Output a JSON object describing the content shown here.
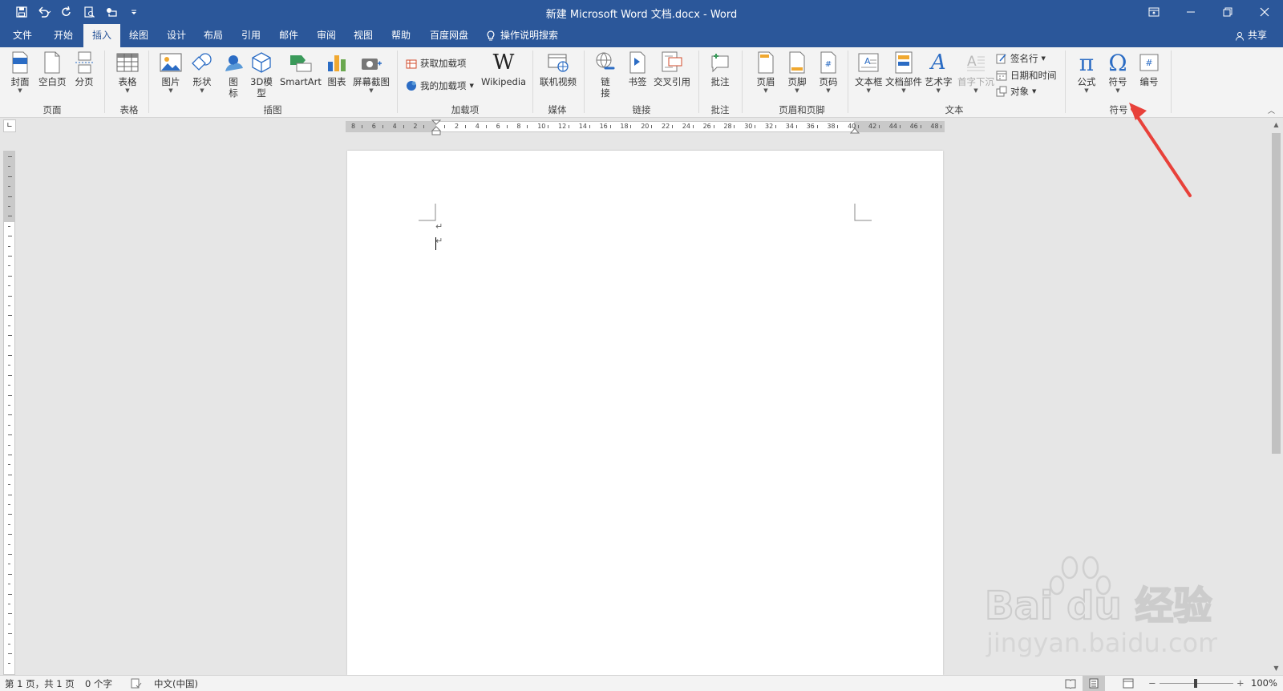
{
  "window": {
    "title": "新建 Microsoft Word 文档.docx  -  Word"
  },
  "tabs": [
    {
      "label": "文件"
    },
    {
      "label": "开始"
    },
    {
      "label": "插入",
      "active": true
    },
    {
      "label": "绘图"
    },
    {
      "label": "设计"
    },
    {
      "label": "布局"
    },
    {
      "label": "引用"
    },
    {
      "label": "邮件"
    },
    {
      "label": "审阅"
    },
    {
      "label": "视图"
    },
    {
      "label": "帮助"
    },
    {
      "label": "百度网盘"
    }
  ],
  "tellme": {
    "label": "操作说明搜索"
  },
  "share": {
    "label": "共享"
  },
  "ribbon": {
    "groups": {
      "pages": "页面",
      "tables": "表格",
      "illustrations": "插图",
      "addins": "加载项",
      "media": "媒体",
      "links": "链接",
      "comments": "批注",
      "header_footer": "页眉和页脚",
      "text": "文本",
      "symbols": "符号"
    },
    "buttons": {
      "cover": "封面",
      "blank_page": "空白页",
      "page_break": "分页",
      "table": "表格",
      "picture": "图片",
      "shapes": "形状",
      "icons": "图标",
      "model3d": "3D模型",
      "smartart": "SmartArt",
      "chart": "图表",
      "screenshot": "屏幕截图",
      "get_addins": "获取加载项",
      "my_addins": "我的加载项",
      "wikipedia": "Wikipedia",
      "online_video": "联机视频",
      "link": "链接",
      "bookmark": "书签",
      "cross_ref": "交叉引用",
      "comment": "批注",
      "header": "页眉",
      "footer": "页脚",
      "page_number": "页码",
      "textbox": "文本框",
      "quick_parts": "文档部件",
      "wordart": "艺术字",
      "dropcap": "首字下沉",
      "signature_line": "签名行",
      "date_time": "日期和时间",
      "object": "对象",
      "equation": "公式",
      "symbol": "符号",
      "numbering": "编号"
    }
  },
  "status": {
    "page": "第 1 页，共 1 页",
    "words": "0 个字",
    "language": "中文(中国)",
    "zoom": "100%"
  },
  "watermark": {
    "brand": "Bai du 经验",
    "url": "jingyan.baidu.com"
  },
  "ruler": {
    "h_labels": [
      "8",
      "6",
      "4",
      "2",
      "",
      "2",
      "4",
      "6",
      "8",
      "10",
      "12",
      "14",
      "16",
      "18",
      "20",
      "22",
      "24",
      "26",
      "28",
      "30",
      "32",
      "34",
      "36",
      "38",
      "40",
      "42",
      "44",
      "46",
      "48"
    ]
  },
  "colors": {
    "brand": "#2b579a",
    "ribbon_bg": "#f3f3f3",
    "annotation": "#e8413a"
  }
}
